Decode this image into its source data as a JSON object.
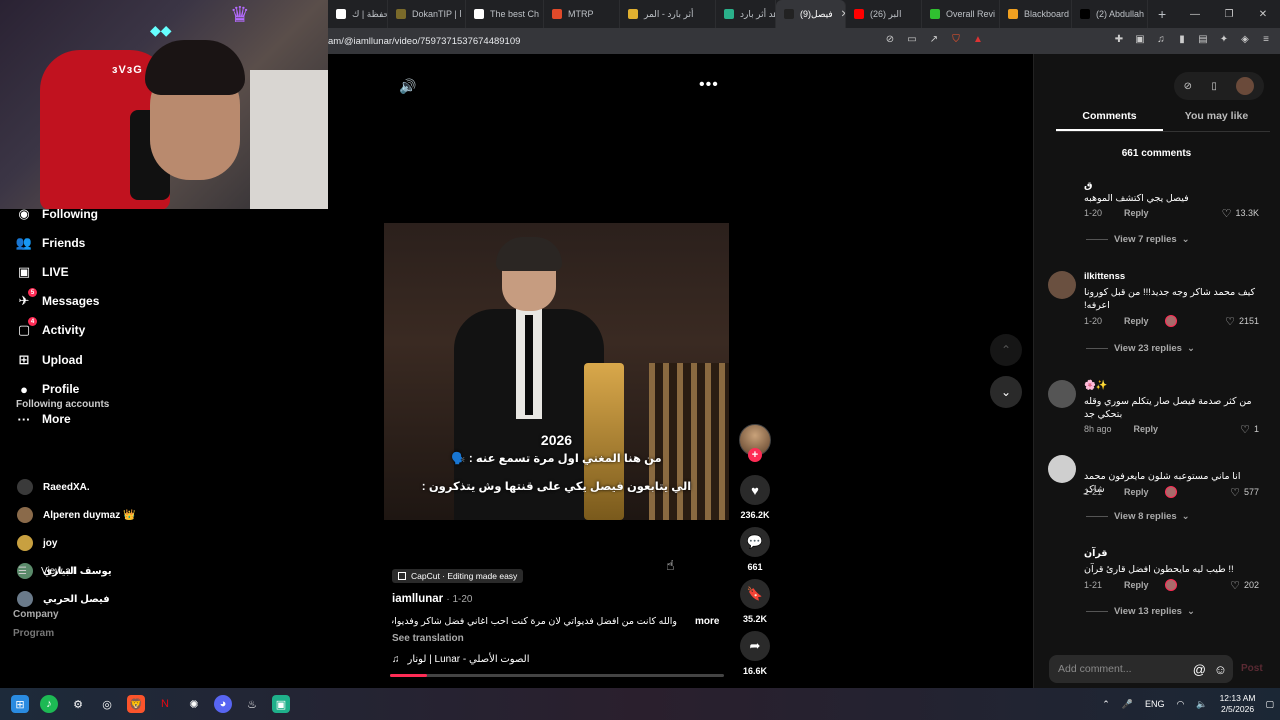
{
  "browser": {
    "tabs": [
      {
        "label": "المحفظة | ك",
        "color": "#ffffff",
        "active": false
      },
      {
        "label": "DokanTIP | ا",
        "color": "#7a6a2a",
        "active": false
      },
      {
        "label": "The best Ch",
        "color": "#ffffff",
        "active": false
      },
      {
        "label": "MTRP",
        "color": "#e04a2a",
        "active": false
      },
      {
        "label": "أثر بارد - المر",
        "color": "#e0b030",
        "active": false
      },
      {
        "label": "شاهد أثر بارد",
        "color": "#2ab08a",
        "active": false
      },
      {
        "label": "(9)فيصل",
        "color": "#222222",
        "active": true
      },
      {
        "label": "(26) البر",
        "color": "#ff0000",
        "active": false
      },
      {
        "label": "Overall Revi",
        "color": "#30c030",
        "active": false
      },
      {
        "label": "Blackboard",
        "color": "#f0a020",
        "active": false
      },
      {
        "label": "(2) Abdullah",
        "color": "#000000",
        "active": false
      }
    ],
    "url": "am/@iamllunar/video/7597371537674489109"
  },
  "webcam": {
    "chair_text": "ɜVɜG"
  },
  "leftnav": {
    "items": [
      {
        "label": "Following",
        "icon": "following-icon",
        "badge": ""
      },
      {
        "label": "Friends",
        "icon": "friends-icon",
        "badge": ""
      },
      {
        "label": "LIVE",
        "icon": "live-icon",
        "badge": ""
      },
      {
        "label": "Messages",
        "icon": "messages-icon",
        "badge": "5"
      },
      {
        "label": "Activity",
        "icon": "activity-icon",
        "badge": "4"
      },
      {
        "label": "Upload",
        "icon": "upload-icon",
        "badge": ""
      },
      {
        "label": "Profile",
        "icon": "profile-icon",
        "badge": ""
      },
      {
        "label": "More",
        "icon": "more-icon",
        "badge": ""
      }
    ],
    "following_title": "Following accounts",
    "accounts": [
      {
        "name": "RaeedXA.",
        "color": "#3a3a3a"
      },
      {
        "name": "Alperen duymaz 👑",
        "color": "#8a6a4a"
      },
      {
        "name": "joy",
        "color": "#c8a040"
      },
      {
        "name": "يوسف البيازي",
        "color": "#5a8a6a"
      },
      {
        "name": "فيصل الحربي",
        "color": "#6a7a8a"
      }
    ],
    "view_all": "View all",
    "company": "Company",
    "program": "Program"
  },
  "video": {
    "caption_year": "2026",
    "caption_line1": "من هنا المغني اول مرة تسمع عنه : 🗣️",
    "caption_line2": "الي يتابعون فيصل يكي على قنتها وش يتذكرون :",
    "capcut_label": "CapCut · Editing made easy",
    "author": "iamllunar",
    "date": "1-20",
    "description": "والله كانت من افضل فديواتي لان مرة كنت احب اغاني فضل شاكر وفديوات",
    "more": "more",
    "see_translation": "See translation",
    "music": "لونار | Lunar - الصوت الأصلي",
    "progress_percent": 11,
    "likes": "236.2K",
    "comments": "661",
    "saves": "35.2K",
    "shares": "16.6K"
  },
  "comments_panel": {
    "tab_comments": "Comments",
    "tab_may_like": "You may like",
    "count_text": "661 comments",
    "comments": [
      {
        "name": "ق",
        "text": "فيصل يجي اكتشف الموهبه",
        "date": "1-20",
        "reply": "Reply",
        "likes": "13.3K",
        "creator_liked": false,
        "view_replies": "View 7 replies",
        "avatar_color": "#121212"
      },
      {
        "name": "ilkittenss",
        "text": "كيف محمد شاكر وجه جديد!!! من قبل كورونا اعرفه!",
        "date": "1-20",
        "reply": "Reply",
        "likes": "2151",
        "creator_liked": true,
        "view_replies": "View 23 replies",
        "avatar_color": "#6a5040"
      },
      {
        "name": "🌸✨",
        "text": "من كثر صدمة فيصل صار يتكلم سوري وقله بتحكي جد",
        "date": "8h ago",
        "reply": "Reply",
        "likes": "1",
        "creator_liked": false,
        "view_replies": "",
        "avatar_color": "#555555"
      },
      {
        "name": "",
        "text": "انا ماني مستوعبه شلون مايعرفون محمد شاكر",
        "date": "1-21",
        "reply": "Reply",
        "likes": "577",
        "creator_liked": true,
        "view_replies": "View 8 replies",
        "avatar_color": "#cfcfcf"
      },
      {
        "name": "قرآن",
        "text": "!! طيب ليه مايحطون افضل قارئ قرآن",
        "date": "1-21",
        "reply": "Reply",
        "likes": "202",
        "creator_liked": true,
        "view_replies": "View 13 replies",
        "avatar_color": "#121212"
      }
    ],
    "add_comment_placeholder": "Add comment...",
    "post": "Post"
  },
  "taskbar": {
    "lang": "ENG",
    "time": "12:13 AM",
    "date": "2/5/2026"
  }
}
